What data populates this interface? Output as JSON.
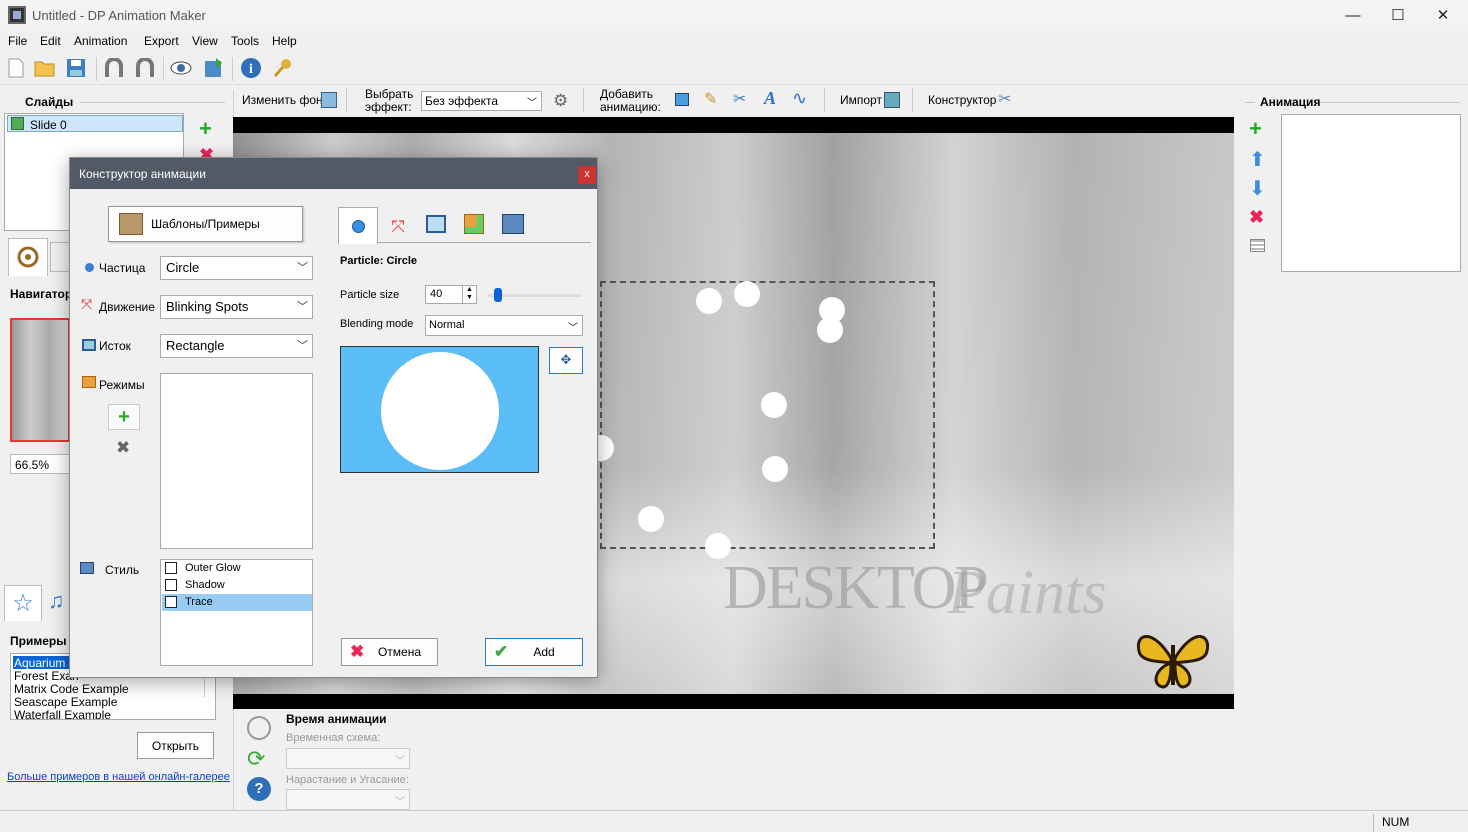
{
  "window": {
    "title": "Untitled - DP Animation Maker",
    "minimize": "—",
    "maximize": "☐",
    "close": "✕"
  },
  "menu": [
    "File",
    "Edit",
    "Animation",
    "Export",
    "View",
    "Tools",
    "Help"
  ],
  "toolbar": {
    "icons": [
      "new-file-icon",
      "open-folder-icon",
      "save-icon",
      "undo-icon",
      "redo-icon",
      "preview-eye-icon",
      "export-film-icon",
      "info-icon",
      "key-icon"
    ]
  },
  "slides": {
    "header": "Слайды",
    "items": [
      "Slide 0"
    ]
  },
  "left": {
    "navigator": "Навигатор",
    "zoom": "66.5%",
    "examples_header": "Примеры в",
    "examples": [
      "Aquarium Ex",
      "Forest Exan",
      "Matrix Code Example",
      "Seascape Example",
      "Waterfall Example"
    ],
    "open_button": "Открыть",
    "gallery_link": "Больше примеров в нашей онлайн-галерее"
  },
  "effects_bar": {
    "change_bg": "Изменить фон",
    "choose_effect_1": "Выбрать",
    "choose_effect_2": "эффект:",
    "effect_value": "Без эффекта",
    "add_anim_1": "Добавить",
    "add_anim_2": "анимацию:",
    "import": "Импорт",
    "constructor": "Конструктор"
  },
  "animation_panel": {
    "header": "Анимация"
  },
  "timing": {
    "header": "Время анимации",
    "scheme_label": "Временная схема:",
    "fade_label": "Нарастание и Угасание:"
  },
  "status": {
    "num": "NUM"
  },
  "watermark": {
    "word1": "DESKTOP",
    "word2": "Paints"
  },
  "dialog": {
    "title": "Конструктор анимации",
    "close": "x",
    "templates_button": "Шаблоны/Примеры",
    "particle_label": "Частица",
    "particle_value": "Circle",
    "motion_label": "Движение",
    "motion_value": "Blinking Spots",
    "source_label": "Исток",
    "source_value": "Rectangle",
    "modes_label": "Режимы",
    "style_label": "Стиль",
    "styles": [
      "Outer Glow",
      "Shadow",
      "Trace"
    ],
    "particle_header": "Particle: Circle",
    "size_label": "Particle size",
    "size_value": "40",
    "blend_label": "Blending mode",
    "blend_value": "Normal",
    "preview_bg": "#5bbdf6",
    "cancel": "Отмена",
    "add": "Add"
  }
}
